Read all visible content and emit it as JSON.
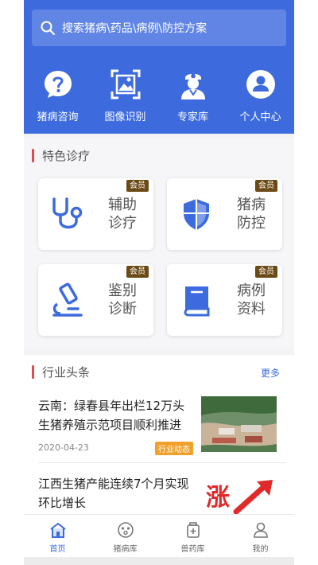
{
  "search": {
    "placeholder": "搜索猪病\\药品\\病例\\防控方案"
  },
  "quick_nav": [
    {
      "label": "猪病咨询",
      "icon": "question-icon"
    },
    {
      "label": "图像识别",
      "icon": "image-scan-icon"
    },
    {
      "label": "专家库",
      "icon": "doctor-icon"
    },
    {
      "label": "个人中心",
      "icon": "user-icon"
    }
  ],
  "featured": {
    "title": "特色诊疗",
    "cards": [
      {
        "label": "辅助诊疗",
        "badge": "会员",
        "icon": "stethoscope-icon"
      },
      {
        "label": "猪病防控",
        "badge": "会员",
        "icon": "shield-icon"
      },
      {
        "label": "鉴别诊断",
        "badge": "会员",
        "icon": "microscope-icon"
      },
      {
        "label": "病例资料",
        "badge": "会员",
        "icon": "book-icon"
      }
    ]
  },
  "news": {
    "title": "行业头条",
    "more": "更多",
    "items": [
      {
        "title": "云南：绿春县年出栏12万头生猪养殖示范项目顺利推进",
        "date": "2020-04-23",
        "tag": "行业动态"
      },
      {
        "title": "江西生猪产能连续7个月实现环比增长",
        "date": "",
        "tag": "",
        "image_text": "涨"
      }
    ]
  },
  "tabs": [
    {
      "label": "首页",
      "icon": "home-icon",
      "active": true
    },
    {
      "label": "猪病库",
      "icon": "disease-library-icon",
      "active": false
    },
    {
      "label": "兽药库",
      "icon": "medicine-library-icon",
      "active": false
    },
    {
      "label": "我的",
      "icon": "profile-icon",
      "active": false
    }
  ],
  "colors": {
    "primary": "#3d6bde",
    "accent_bar": "#e54b4b",
    "badge": "#6b4a16",
    "tag": "#f0a12c"
  }
}
